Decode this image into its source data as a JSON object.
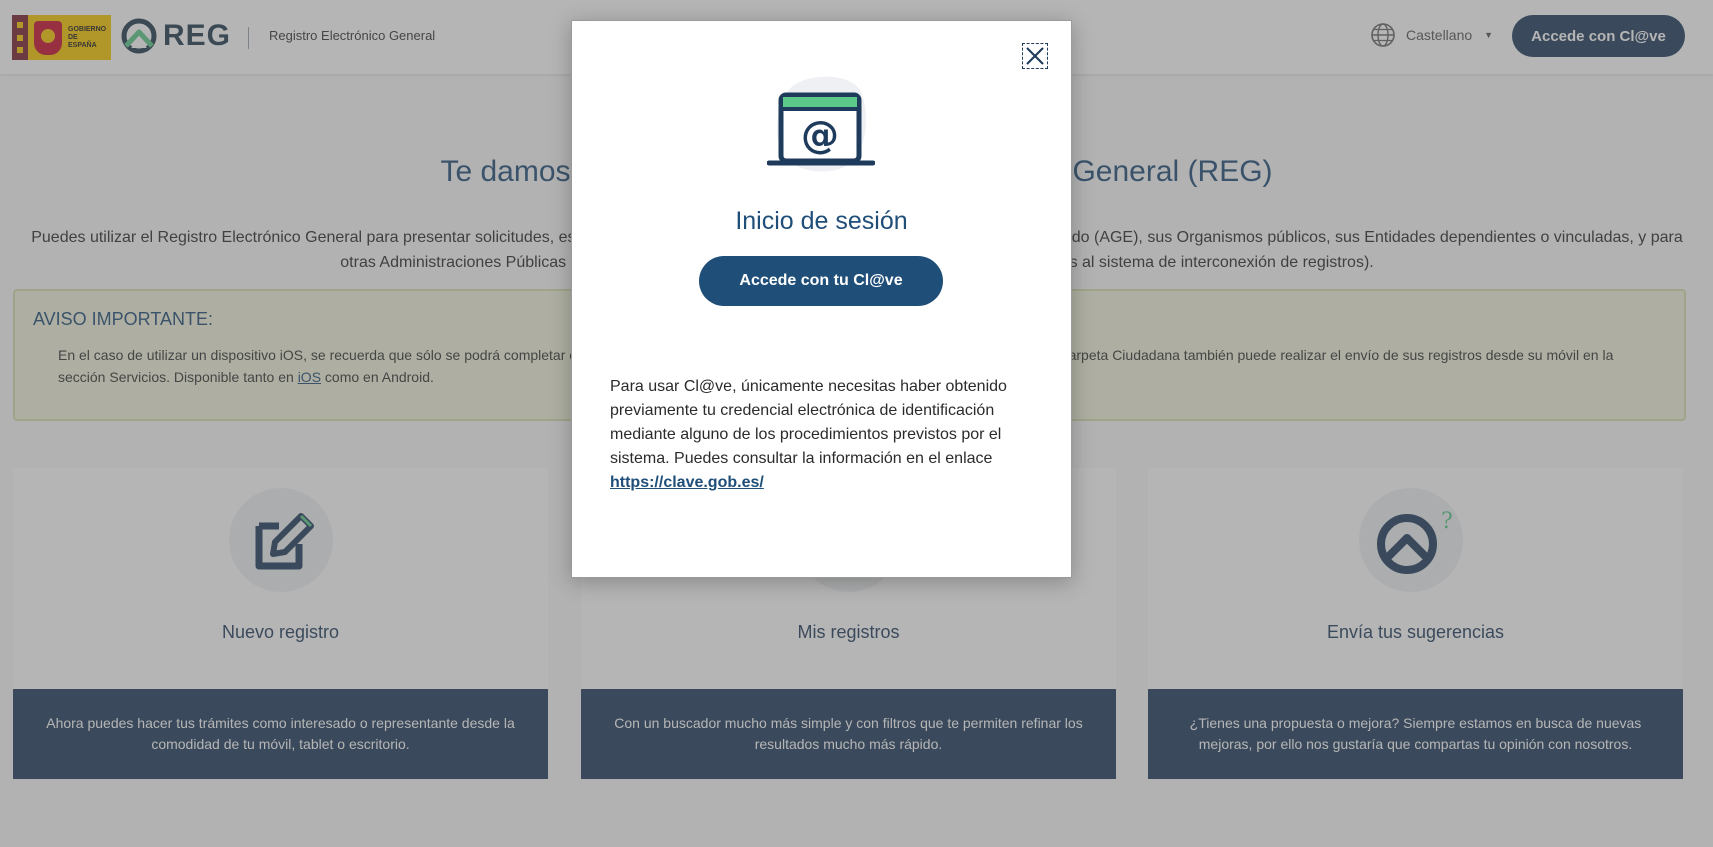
{
  "header": {
    "gov_logo_text": "GOBIERNO DE ESPAÑA",
    "brand": "REG",
    "subtitle": "Registro Electrónico General",
    "language": "Castellano",
    "login_button": "Accede con Cl@ve"
  },
  "main": {
    "welcome_title": "Te damos la bienvenida al Registro Electrónico General (REG)",
    "intro": "Puedes utilizar el Registro Electrónico General para presentar solicitudes, escritos y comunicaciones dirigidas a la Administración General del Estado (AGE), sus Organismos públicos, sus Entidades dependientes o vinculadas, y para otras Administraciones Públicas (comunidades autónomas, entidades locales y universidades adheridas al sistema de interconexión de registros).",
    "notice": {
      "title": "AVISO IMPORTANTE:",
      "text_before_ios": "En el caso de utilizar un dispositivo iOS, se recuerda que sólo se podrá completar el proceso de firma de su registro utilizando el navegador Safari. En la APP Mi Carpeta Ciudadana también puede realizar el envío de sus registros desde su móvil en la sección Servicios. Disponible tanto en ",
      "ios_link": "iOS",
      "text_after_ios": " como en Android."
    },
    "cards": [
      {
        "title": "Nuevo registro",
        "description": "Ahora puedes hacer tus trámites como interesado o representante desde la comodidad de tu móvil, tablet o escritorio."
      },
      {
        "title": "Mis registros",
        "description": "Con un buscador mucho más simple y con filtros que te permiten refinar los resultados mucho más rápido."
      },
      {
        "title": "Envía tus sugerencias",
        "description": "¿Tienes una propuesta o mejora? Siempre estamos en busca de nuevas mejoras, por ello nos gustaría que compartas tu opinión con nosotros."
      }
    ]
  },
  "modal": {
    "title": "Inicio de sesión",
    "button": "Accede con tu Cl@ve",
    "text": "Para usar Cl@ve, únicamente necesitas haber obtenido previamente tu credencial electrónica de identificación mediante alguno de los procedimientos previstos por el sistema. Puedes consultar la información en el enlace",
    "link": "https://clave.gob.es/"
  },
  "colors": {
    "primary": "#1f4e79",
    "dark_blue": "#1f3b5c",
    "notice_bg": "#f2f5dc",
    "accent_green": "#5cc98a"
  },
  "icons": [
    "close-icon",
    "globe-icon",
    "edit-icon",
    "folder-icon",
    "reg-help-icon",
    "email-window-icon"
  ]
}
